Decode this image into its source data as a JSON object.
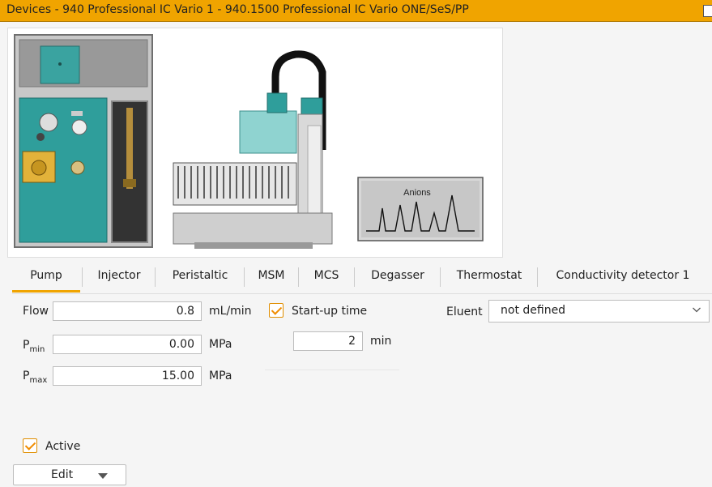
{
  "window": {
    "title": "Devices - 940 Professional IC Vario 1 - 940.1500 Professional IC Vario ONE/SeS/PP"
  },
  "device_image": {
    "chromatogram_label": "Anions"
  },
  "tabs": [
    {
      "label": "Pump",
      "active": true
    },
    {
      "label": "Injector",
      "active": false
    },
    {
      "label": "Peristaltic",
      "active": false
    },
    {
      "label": "MSM",
      "active": false
    },
    {
      "label": "MCS",
      "active": false
    },
    {
      "label": "Degasser",
      "active": false
    },
    {
      "label": "Thermostat",
      "active": false
    },
    {
      "label": "Conductivity detector 1",
      "active": false
    }
  ],
  "pump": {
    "flow": {
      "label": "Flow",
      "value": "0.8",
      "unit": "mL/min"
    },
    "pmin": {
      "label_main": "P",
      "label_sub": "min",
      "value": "0.00",
      "unit": "MPa"
    },
    "pmax": {
      "label_main": "P",
      "label_sub": "max",
      "value": "15.00",
      "unit": "MPa"
    },
    "startup": {
      "label": "Start-up time",
      "checked": true,
      "value": "2",
      "unit": "min"
    },
    "eluent": {
      "label": "Eluent",
      "value": "not defined"
    }
  },
  "footer": {
    "active_label": "Active",
    "active_checked": true,
    "edit_label": "Edit"
  },
  "colors": {
    "accent": "#f0a400",
    "device_teal": "#2e9c9a",
    "device_grey": "#9a9a9a"
  }
}
